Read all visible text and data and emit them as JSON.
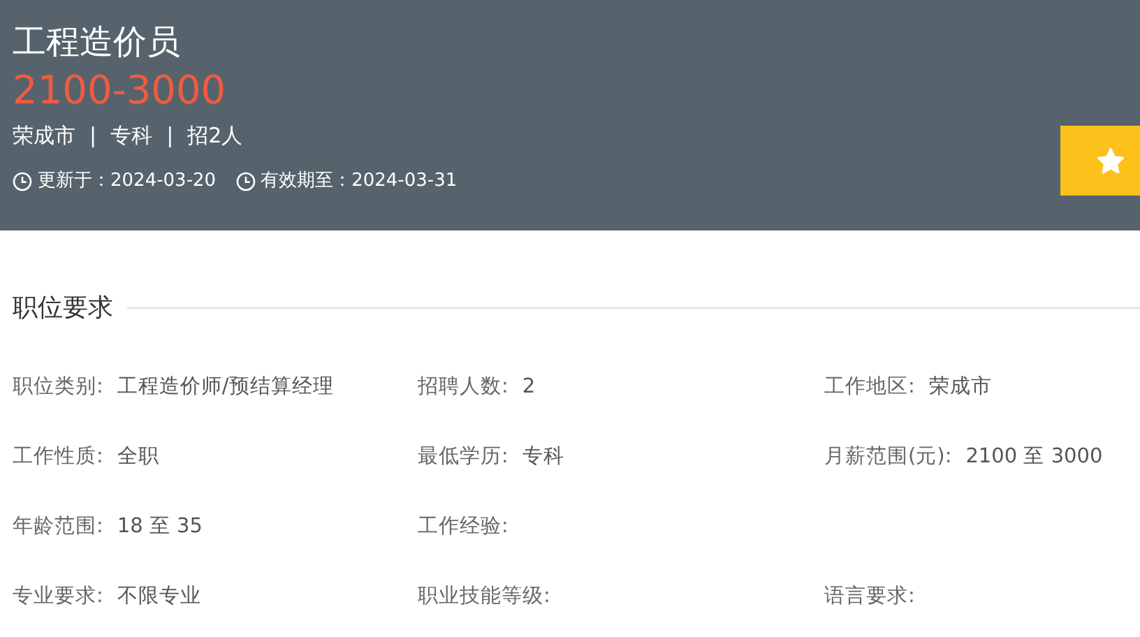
{
  "job": {
    "title": "工程造价员",
    "salary": "2100-3000",
    "summary": [
      "荣成市",
      "专科",
      "招2人"
    ],
    "separator": "|",
    "dates": [
      {
        "text": "更新于：2024-03-20"
      },
      {
        "text": "有效期至：2024-03-31"
      }
    ]
  },
  "section": {
    "title": "职位要求"
  },
  "rows": [
    [
      {
        "label": "职位类别:",
        "value": "工程造价师/预结算经理"
      },
      {
        "label": "招聘人数:",
        "value": "2"
      },
      {
        "label": "工作地区:",
        "value": "荣成市"
      }
    ],
    [
      {
        "label": "工作性质:",
        "value": "全职"
      },
      {
        "label": "最低学历:",
        "value": "专科"
      },
      {
        "label": "月薪范围(元):",
        "value": "2100 至 3000"
      }
    ],
    [
      {
        "label": "年龄范围:",
        "value": "18 至 35"
      },
      {
        "label": "工作经验:"
      }
    ],
    [
      {
        "label": "专业要求:",
        "value": "不限专业"
      },
      {
        "label": "职业技能等级:"
      },
      {
        "label": "语言要求:"
      }
    ]
  ]
}
